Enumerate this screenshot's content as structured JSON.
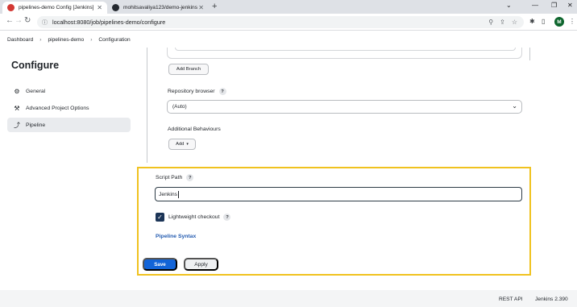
{
  "browser": {
    "tabs": [
      {
        "title": "pipelines-demo Config [Jenkins]"
      },
      {
        "title": "mohitsavaliya123/demo-jenkins"
      }
    ],
    "url": "localhost:8080/job/pipelines-demo/configure",
    "profile_initial": "M"
  },
  "breadcrumb": [
    "Dashboard",
    "pipelines-demo",
    "Configuration"
  ],
  "sidebar": {
    "title": "Configure",
    "items": [
      {
        "label": "General",
        "icon": "gear-icon"
      },
      {
        "label": "Advanced Project Options",
        "icon": "wrench-icon"
      },
      {
        "label": "Pipeline",
        "icon": "pipeline-icon"
      }
    ]
  },
  "scm": {
    "add_branch": "Add Branch",
    "repository_browser_label": "Repository browser",
    "repository_browser_value": "(Auto)",
    "additional_behaviours_label": "Additional Behaviours",
    "add_button": "Add"
  },
  "script": {
    "path_label": "Script Path",
    "path_value": "Jenkins",
    "lightweight_label": "Lightweight checkout",
    "lightweight_checked": true,
    "syntax_link": "Pipeline Syntax"
  },
  "actions": {
    "save": "Save",
    "apply": "Apply"
  },
  "footer": {
    "rest_api": "REST API",
    "version": "Jenkins 2.390"
  },
  "colors": {
    "highlight": "#f0c21f",
    "primary": "#1264d8",
    "link": "#235bb0"
  }
}
